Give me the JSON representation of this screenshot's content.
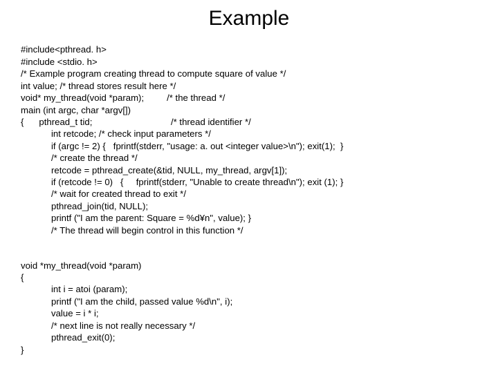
{
  "title": "Example",
  "block1": {
    "l0": "#include<pthread. h>",
    "l1": "#include <stdio. h>",
    "l2": "/* Example program creating thread to compute square of value */",
    "l3": "int value; /* thread stores result here */",
    "l4": "void* my_thread(void *param);         /* the thread */",
    "l5": "main (int argc, char *argv[])",
    "l6": "{      pthread_t tid;                               /* thread identifier */",
    "l7": "int retcode; /* check input parameters */",
    "l8": "if (argc != 2) {   fprintf(stderr, \"usage: a. out <integer value>\\n\"); exit(1);  }",
    "l9": "/* create the thread */",
    "l10": "retcode = pthread_create(&tid, NULL, my_thread, argv[1]);",
    "l11": "if (retcode != 0)   {     fprintf(stderr, \"Unable to create thread\\n\"); exit (1); }",
    "l12": "/* wait for created thread to exit */",
    "l13": "pthread_join(tid, NULL);",
    "l14": "printf (\"I am the parent: Square = %d¥n\", value); }",
    "l15": "/* The thread will begin control in this function */"
  },
  "block2": {
    "l0": "void *my_thread(void *param)",
    "l1": "{",
    "l2": "int i = atoi (param);",
    "l3": "printf (\"I am the child, passed value %d\\n\", i);",
    "l4": "value = i * i;",
    "l5": "/* next line is not really necessary */",
    "l6": "pthread_exit(0);",
    "l7": "}"
  }
}
